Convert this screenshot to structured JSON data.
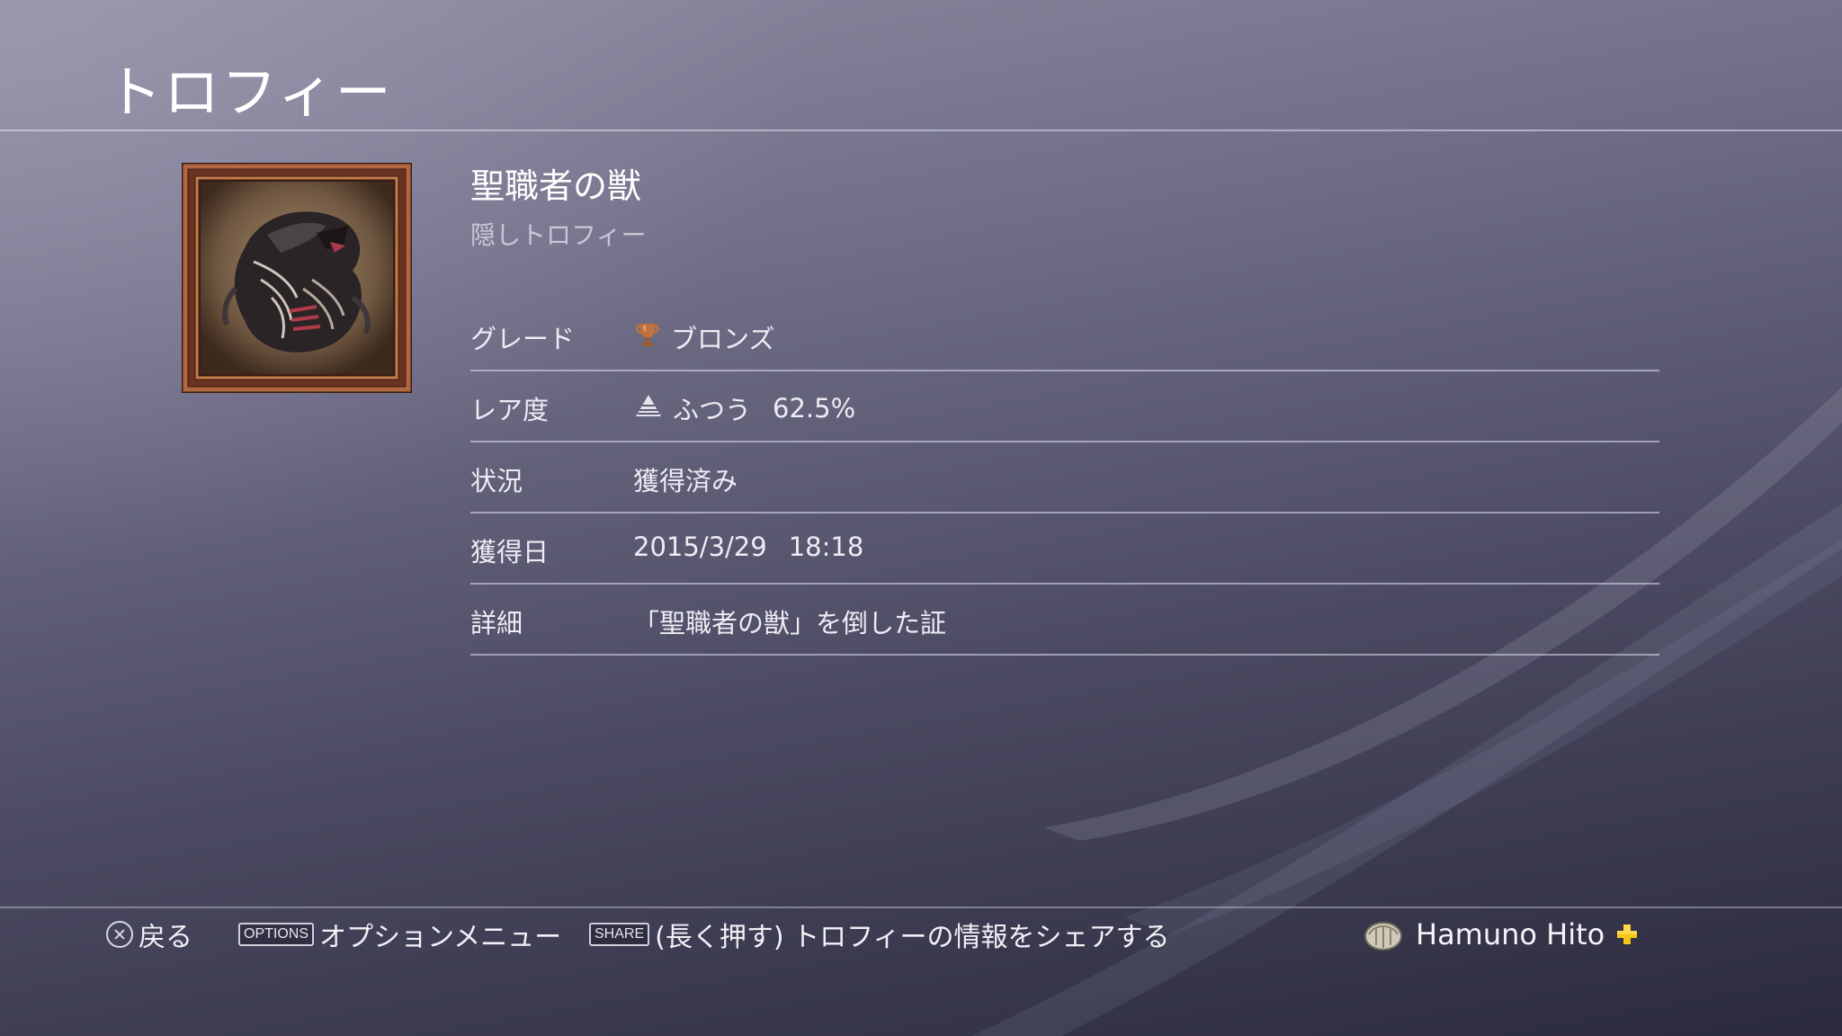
{
  "header": {
    "title": "トロフィー"
  },
  "trophy": {
    "name": "聖職者の獣",
    "type_label": "隠しトロフィー",
    "art_icon": "cleric-beast-trophy-art"
  },
  "details": {
    "grade": {
      "label": "グレード",
      "icon": "bronze-trophy-icon",
      "value": "ブロンズ",
      "color": "#c2713a"
    },
    "rarity": {
      "label": "レア度",
      "icon": "rarity-common-icon",
      "value": "ふつう",
      "percent": "62.5%"
    },
    "status": {
      "label": "状況",
      "value": "獲得済み"
    },
    "earned": {
      "label": "獲得日",
      "date": "2015/3/29",
      "time": "18:18"
    },
    "detail": {
      "label": "詳細",
      "value": "「聖職者の獣」を倒した証"
    }
  },
  "footer": {
    "back": {
      "button": "cross-button-icon",
      "label": "戻る"
    },
    "options": {
      "key": "OPTIONS",
      "label": "オプションメニュー"
    },
    "share": {
      "key": "SHARE",
      "label": "(長く押す) トロフィーの情報をシェアする"
    }
  },
  "user": {
    "name": "Hamuno Hito",
    "plus_icon": "playstation-plus-icon",
    "plus_color": "#f5c518"
  },
  "theme": {
    "background": "#5e5d75",
    "text": "#f1f1f6",
    "divider": "#e1e1f0"
  }
}
